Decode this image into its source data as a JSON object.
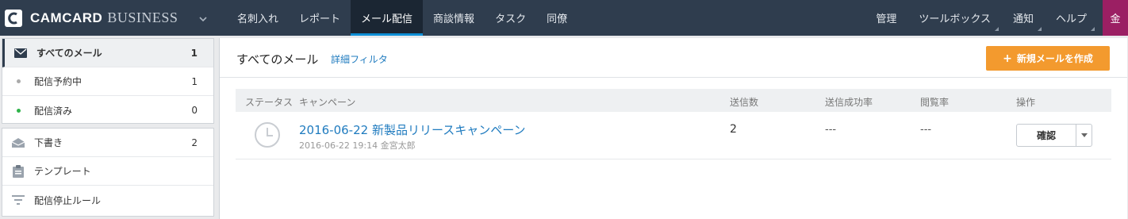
{
  "brand": {
    "name": "CAMCARD",
    "suffix": "BUSINESS"
  },
  "nav": {
    "tabs": [
      {
        "label": "名刺入れ"
      },
      {
        "label": "レポート"
      },
      {
        "label": "メール配信"
      },
      {
        "label": "商談情報"
      },
      {
        "label": "タスク"
      },
      {
        "label": "同僚"
      }
    ],
    "active_tab": "メール配信",
    "right": [
      {
        "label": "管理"
      },
      {
        "label": "ツールボックス"
      },
      {
        "label": "通知"
      },
      {
        "label": "ヘルプ"
      }
    ],
    "avatar": "金"
  },
  "sidebar": {
    "group1": [
      {
        "label": "すべてのメール",
        "count": "1",
        "icon": "envelope-icon"
      },
      {
        "label": "配信予約中",
        "count": "1",
        "icon": "gray-dot-icon"
      },
      {
        "label": "配信済み",
        "count": "0",
        "icon": "green-dot-icon"
      }
    ],
    "group2": [
      {
        "label": "下書き",
        "count": "2",
        "icon": "draft-envelope-icon"
      },
      {
        "label": "テンプレート",
        "icon": "clipboard-icon"
      },
      {
        "label": "配信停止ルール",
        "icon": "filter-icon"
      }
    ]
  },
  "main": {
    "title": "すべてのメール",
    "filter_link": "詳細フィルタ",
    "new_button": "新規メールを作成",
    "columns": {
      "status": "ステータス",
      "campaign": "キャンペーン",
      "sent": "送信数",
      "success_rate": "送信成功率",
      "open_rate": "閲覧率",
      "actions": "操作"
    },
    "rows": [
      {
        "status_icon": "clock-icon",
        "campaign": "2016-06-22 新製品リリースキャンペーン",
        "meta": "2016-06-22 19:14 金宮太郎",
        "sent": "2",
        "success_rate": "---",
        "open_rate": "---",
        "action": "確認"
      }
    ]
  },
  "colors": {
    "topbar": "#2f3d4e",
    "accent": "#f39a2e",
    "link": "#1f7bbf",
    "avatar": "#9b1f63"
  }
}
